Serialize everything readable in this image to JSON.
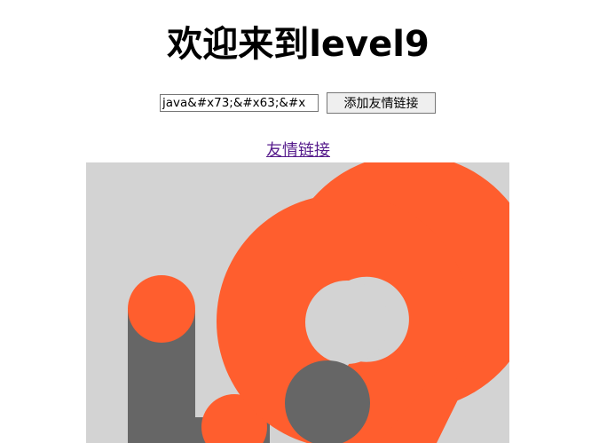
{
  "heading": "欢迎来到level9",
  "form": {
    "input_value": "java&#x73;&#x63;&#x",
    "submit_label": "添加友情链接"
  },
  "link": {
    "label": "友情链接"
  },
  "logo": {
    "icon": "level9-logo-icon",
    "colors": {
      "background": "#d3d3d3",
      "orange": "#ff5e2e",
      "gray": "#666666"
    }
  }
}
